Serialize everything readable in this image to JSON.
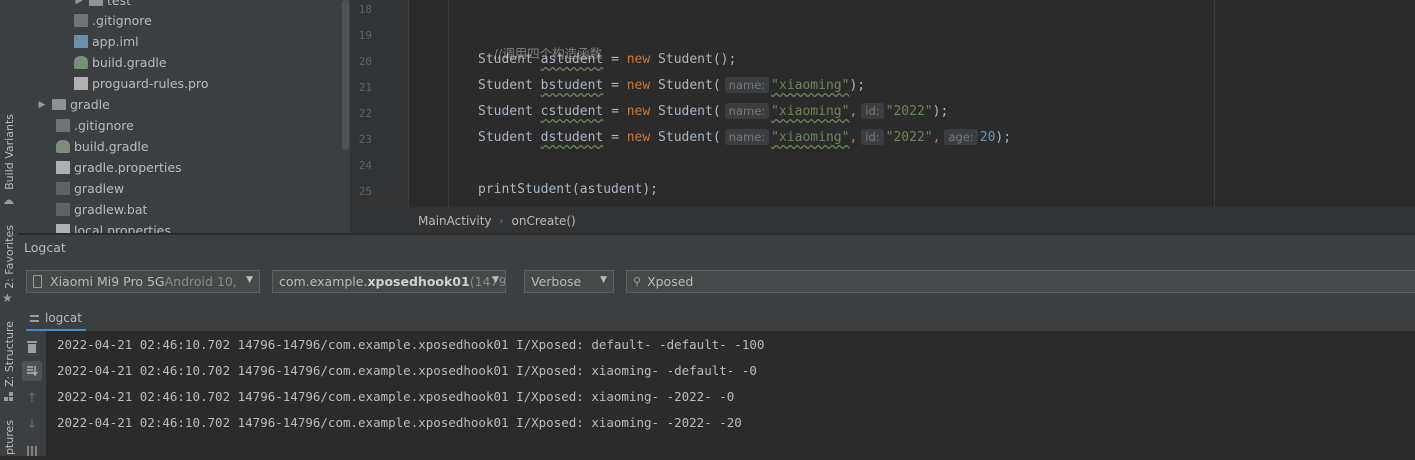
{
  "left_strip": {
    "tabs": [
      "Build Variants",
      "2: Favorites",
      "Z: Structure",
      "ptures"
    ]
  },
  "project_tree": {
    "items": [
      {
        "label": "test",
        "icon": "folder-icon",
        "expander": "collapsed"
      },
      {
        "label": ".gitignore",
        "icon": "git-file-icon"
      },
      {
        "label": "app.iml",
        "icon": "iml-file-icon"
      },
      {
        "label": "build.gradle",
        "icon": "gradle-file-icon"
      },
      {
        "label": "proguard-rules.pro",
        "icon": "properties-file-icon"
      },
      {
        "label": "gradle",
        "icon": "folder-icon",
        "expander": "collapsed"
      },
      {
        "label": ".gitignore",
        "icon": "git-file-icon"
      },
      {
        "label": "build.gradle",
        "icon": "gradle-file-icon"
      },
      {
        "label": "gradle.properties",
        "icon": "properties-file-icon"
      },
      {
        "label": "gradlew",
        "icon": "shell-file-icon"
      },
      {
        "label": "gradlew.bat",
        "icon": "text-file-icon"
      },
      {
        "label": "local.properties",
        "icon": "properties-file-icon"
      }
    ]
  },
  "editor": {
    "line_numbers": [
      "18",
      "19",
      "20",
      "21",
      "22",
      "23",
      "24",
      "25"
    ],
    "comment": "//调用四个构造函数",
    "lines": {
      "a": {
        "type": "Student",
        "var": "astudent",
        "eq": " = ",
        "kw": "new",
        "ctor": " Student();"
      },
      "b": {
        "type": "Student",
        "var": "bstudent",
        "eq": " = ",
        "kw": "new",
        "ctor": " Student(",
        "hint1": "name:",
        "arg1": "\"xiaoming\"",
        "end": ");"
      },
      "c": {
        "type": "Student",
        "var": "cstudent",
        "eq": " = ",
        "kw": "new",
        "ctor": " Student(",
        "hint1": "name:",
        "arg1": "\"xiaoming\"",
        "hint2": "id:",
        "arg2": "\"2022\"",
        "end": ");"
      },
      "d": {
        "type": "Student",
        "var": "dstudent",
        "eq": " = ",
        "kw": "new",
        "ctor": " Student(",
        "hint1": "name:",
        "arg1": "\"xiaoming\"",
        "hint2": "id:",
        "arg2": "\"2022\"",
        "hint3": "age:",
        "arg3": "20",
        "end": ");"
      }
    },
    "print_line": "printStudent(astudent);",
    "colors": {
      "keyword": "#cc7832",
      "string": "#6a8759",
      "number": "#6897bb",
      "comment": "#808080",
      "text": "#a9b7c6"
    }
  },
  "breadcrumb": {
    "items": [
      "MainActivity",
      "onCreate()"
    ]
  },
  "logcat": {
    "title": "Logcat",
    "device": {
      "name": "Xiaomi Mi9 Pro 5G",
      "detail": " Android 10,"
    },
    "process": {
      "prefix": "com.example.",
      "bold": "xposedhook01",
      "detail": " (1479"
    },
    "level": "Verbose",
    "search_value": "Xposed",
    "tab_label": "logcat",
    "lines": [
      "2022-04-21 02:46:10.702 14796-14796/com.example.xposedhook01 I/Xposed: default- -default- -100",
      "2022-04-21 02:46:10.702 14796-14796/com.example.xposedhook01 I/Xposed: xiaoming- -default- -0",
      "2022-04-21 02:46:10.702 14796-14796/com.example.xposedhook01 I/Xposed: xiaoming- -2022- -0",
      "2022-04-21 02:46:10.702 14796-14796/com.example.xposedhook01 I/Xposed: xiaoming- -2022- -20"
    ]
  }
}
